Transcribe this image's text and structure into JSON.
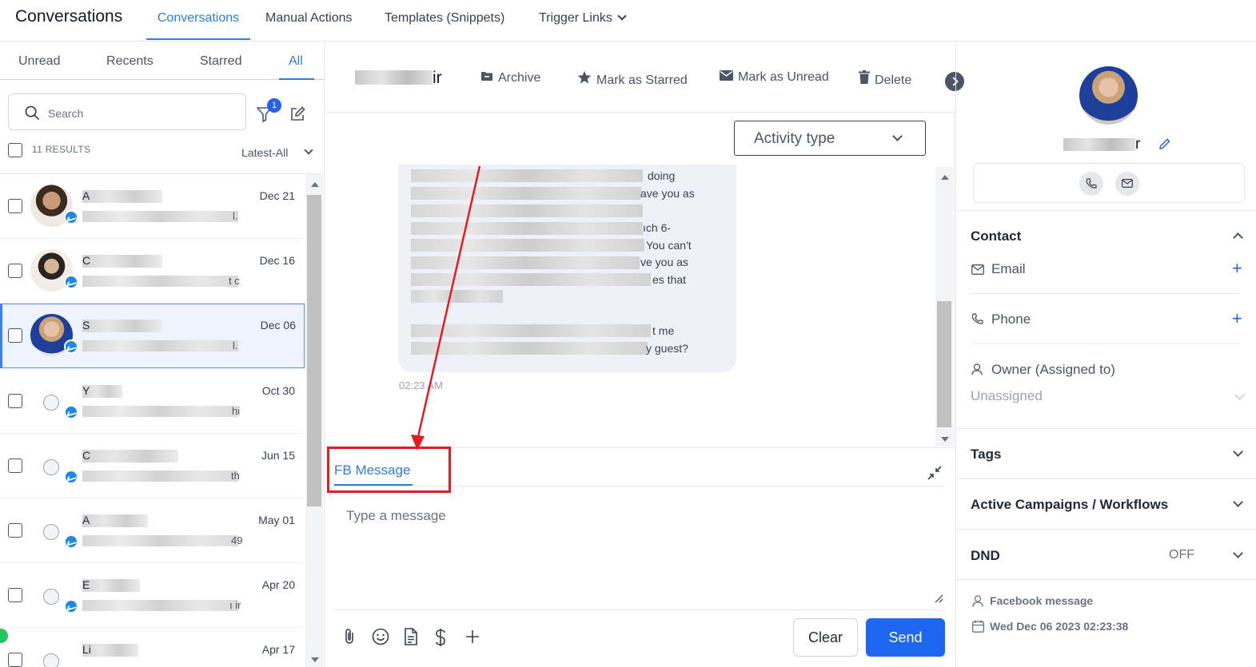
{
  "app": {
    "title": "Conversations"
  },
  "top_nav": {
    "tabs": [
      "Conversations",
      "Manual Actions",
      "Templates (Snippets)",
      "Trigger Links"
    ]
  },
  "left": {
    "tabs": [
      "Unread",
      "Recents",
      "Starred",
      "All"
    ],
    "search_placeholder": "Search",
    "filter_badge": "1",
    "results": "11 RESULTS",
    "sort": "Latest-All",
    "conversations": [
      {
        "initial": "A",
        "snippet_end": "l.",
        "date": "Dec 21"
      },
      {
        "initial": "C",
        "snippet_end": "t c",
        "date": "Dec 16"
      },
      {
        "initial": "S",
        "snippet_end": "l.",
        "date": "Dec 06"
      },
      {
        "initial": "Y",
        "snippet_end": "hi",
        "date": "Oct 30"
      },
      {
        "initial": "C",
        "snippet_end": "th",
        "date": "Jun 15"
      },
      {
        "initial": "A",
        "snippet_end": "49",
        "date": "May 01"
      },
      {
        "initial": "E",
        "snippet_end": "ı ir",
        "date": "Apr 20"
      },
      {
        "initial": "Li",
        "snippet_end": "",
        "date": "Apr 17"
      }
    ]
  },
  "header": {
    "name_tail": "ir",
    "actions": {
      "archive": "Archive",
      "star": "Mark as Starred",
      "unread": "Mark as Unread",
      "delete": "Delete"
    }
  },
  "chat": {
    "activity_type": "Activity type",
    "fragments": [
      "doing",
      "ave you as",
      "ıch 6-",
      "You can't",
      "ve you as",
      "es that",
      "t me",
      "y guest?"
    ],
    "time": "02:23 AM"
  },
  "composer": {
    "channel_tab": "FB Message",
    "placeholder": "Type a message",
    "clear": "Clear",
    "send": "Send"
  },
  "right_panel": {
    "name_tail": "r",
    "sections": {
      "contact": "Contact",
      "email": "Email",
      "phone": "Phone",
      "owner": "Owner (Assigned to)",
      "owner_value": "Unassigned",
      "tags": "Tags",
      "campaigns": "Active Campaigns / Workflows",
      "dnd": "DND",
      "dnd_value": "OFF"
    },
    "source": "Facebook message",
    "timestamp": "Wed Dec 06 2023 02:23:38"
  },
  "colors": {
    "accent": "#2b7fd4",
    "send": "#1d66f0",
    "highlight": "#e11d1d",
    "messenger": "#1e88e5"
  }
}
